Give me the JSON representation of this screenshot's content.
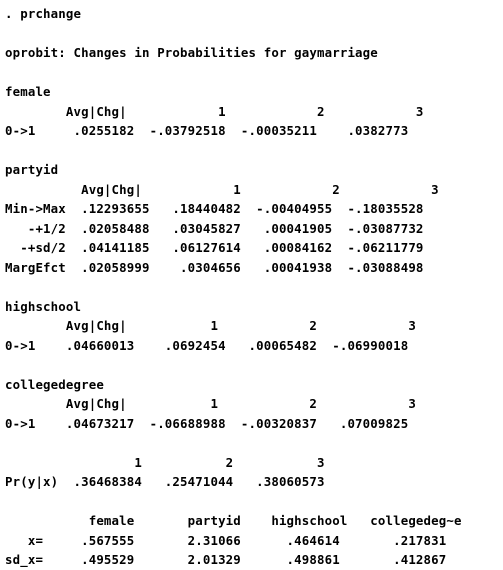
{
  "terminal": {
    "background_color": "#ffffff",
    "text_color": "#000000",
    "command_prompt": ". prchange",
    "title_line": "oprobit: Changes in Probabilities for gaymarriage"
  },
  "sections": {
    "female": {
      "name": "female",
      "header": "        Avg|Chg|            1            2            3",
      "rows": [
        "0->1     .0255182  -.03792518  -.00035211    .0382773"
      ]
    },
    "partyid": {
      "name": "partyid",
      "header": "          Avg|Chg|            1            2            3",
      "rows": [
        "Min->Max  .12293655   .18440482  -.00404955  -.18035528",
        "   -+1/2  .02058488   .03045827   .00041905  -.03087732",
        "  -+sd/2  .04141185   .06127614   .00084162  -.06211779",
        "MargEfct  .02058999    .0304656   .00041938  -.03088498"
      ]
    },
    "highschool": {
      "name": "highschool",
      "header": "        Avg|Chg|           1            2            3",
      "rows": [
        "0->1    .04660013    .0692454   .00065482  -.06990018"
      ]
    },
    "collegedegree": {
      "name": "collegedegree",
      "header": "        Avg|Chg|           1            2            3",
      "rows": [
        "0->1    .04673217  -.06688988  -.00320837   .07009825"
      ]
    }
  },
  "predicted_probabilities": {
    "header": "                 1           2           3",
    "row": "Pr(y|x)  .36468384   .25471044   .38060573"
  },
  "variable_means": {
    "header": "           female       partyid    highschool   collegedeg~e",
    "rows": [
      "   x=     .567555       2.31066      .464614       .217831",
      "sd_x=     .495529       2.01329      .498861       .412867"
    ]
  },
  "lines": [
    ". prchange",
    "",
    "oprobit: Changes in Probabilities for gaymarriage",
    "",
    "female",
    "        Avg|Chg|            1            2            3",
    "0->1     .0255182  -.03792518  -.00035211    .0382773",
    "",
    "partyid",
    "          Avg|Chg|            1            2            3",
    "Min->Max  .12293655   .18440482  -.00404955  -.18035528",
    "   -+1/2  .02058488   .03045827   .00041905  -.03087732",
    "  -+sd/2  .04141185   .06127614   .00084162  -.06211779",
    "MargEfct  .02058999    .0304656   .00041938  -.03088498",
    "",
    "highschool",
    "        Avg|Chg|           1            2            3",
    "0->1    .04660013    .0692454   .00065482  -.06990018",
    "",
    "collegedegree",
    "        Avg|Chg|           1            2            3",
    "0->1    .04673217  -.06688988  -.00320837   .07009825",
    "",
    "                 1           2           3",
    "Pr(y|x)  .36468384   .25471044   .38060573",
    "",
    "           female       partyid    highschool   collegedeg~e",
    "   x=     .567555       2.31066      .464614       .217831",
    "sd_x=     .495529       2.01329      .498861       .412867"
  ]
}
